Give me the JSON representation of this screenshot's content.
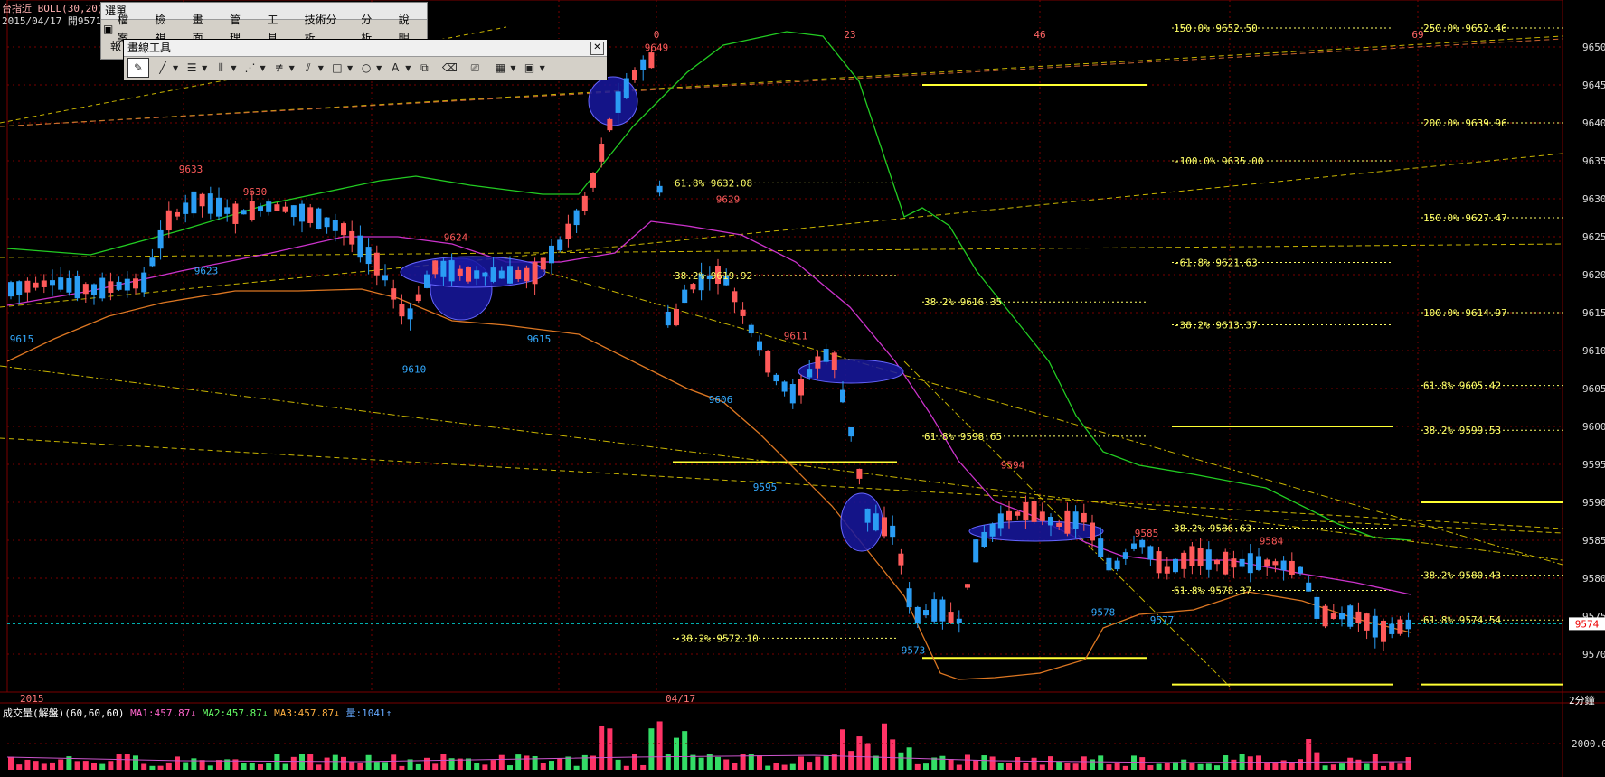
{
  "header": {
    "line1": "台指近 BOLL(30,20)",
    "line2": "2015/04/17 開9571"
  },
  "menu_window": {
    "title": "選單",
    "items": [
      "檔案",
      "檢視",
      "畫面",
      "管理",
      "工具",
      "技術分析",
      "分析",
      "說明"
    ],
    "partial_label": "報"
  },
  "draw_toolbar": {
    "title": "畫線工具",
    "close": "✕",
    "icons": [
      "select-draw-icon",
      "line-icon",
      "horizontal-lines-icon",
      "vertical-lines-icon",
      "fan-icon",
      "fib-lines-icon",
      "parallel-lines-icon",
      "rectangle-icon",
      "ellipse-icon",
      "text-icon",
      "copy-icon",
      "eraser-icon",
      "clear-icon",
      "color-palette-icon",
      "save-icon"
    ]
  },
  "price_axis": [
    "9650",
    "9645",
    "9640",
    "9635",
    "9630",
    "9625",
    "9620",
    "9615",
    "9610",
    "9605",
    "9600",
    "9595",
    "9590",
    "9585",
    "9580",
    "9575",
    "9570"
  ],
  "current_price": "9574",
  "time_axis": {
    "left": "2015",
    "mid": "04/17",
    "interval": "2分鐘"
  },
  "top_markers": [
    "0",
    "23",
    "46",
    "69"
  ],
  "volume_header": {
    "title": "成交量(解盤)(60,60,60)",
    "ma1": "MA1:457.87↓",
    "ma2": "MA2:457.87↓",
    "ma3": "MA3:457.87↓",
    "vol": "量:1041↑"
  },
  "volume_axis": "2000.0",
  "price_labels": [
    {
      "t": "9649",
      "c": "red"
    },
    {
      "t": "9633",
      "c": "red"
    },
    {
      "t": "9630",
      "c": "red"
    },
    {
      "t": "9624",
      "c": "red"
    },
    {
      "t": "9629",
      "c": "red"
    },
    {
      "t": "9611",
      "c": "red"
    },
    {
      "t": "9594",
      "c": "red"
    },
    {
      "t": "9585",
      "c": "red"
    },
    {
      "t": "9584",
      "c": "red"
    },
    {
      "t": "9615",
      "c": "blue"
    },
    {
      "t": "9623",
      "c": "blue"
    },
    {
      "t": "9610",
      "c": "blue"
    },
    {
      "t": "9615",
      "c": "blue"
    },
    {
      "t": "9606",
      "c": "blue"
    },
    {
      "t": "9595",
      "c": "blue"
    },
    {
      "t": "9573",
      "c": "blue"
    },
    {
      "t": "9578",
      "c": "blue"
    },
    {
      "t": "9577",
      "c": "blue"
    }
  ],
  "fib_labels": [
    "150.0% 9652.50",
    "-100.0% 9635.00",
    "-61.8% 9621.63",
    "-38.2% 9613.37",
    "38.2% 9586.63",
    "61.8% 9578.37",
    "250.0% 9652.46",
    "200.0% 9639.96",
    "150.0% 9627.47",
    "100.0% 9614.97",
    "61.8% 9605.42",
    "38.2% 9599.53",
    "38.2% 9580.43",
    "61.8% 9574.54",
    "61.8% 9632.08",
    "38.2% 9619.92",
    "-38.2% 9572.10",
    "38.2% 9616.35",
    "61.8% 9598.65"
  ],
  "colors": {
    "bg": "#000000",
    "up": "#ff5a5a",
    "down": "#2a9df4",
    "grid": "#7a0000",
    "upper_band": "#22cc22",
    "mid_band": "#cc33cc",
    "lower_band": "#dd7722",
    "fib": "#ffff66",
    "trend": "#c8b400",
    "price_line": "#00c8c8",
    "vol_up": "#ff3366",
    "vol_down": "#33dd66",
    "highlight": "#1818a0"
  }
}
